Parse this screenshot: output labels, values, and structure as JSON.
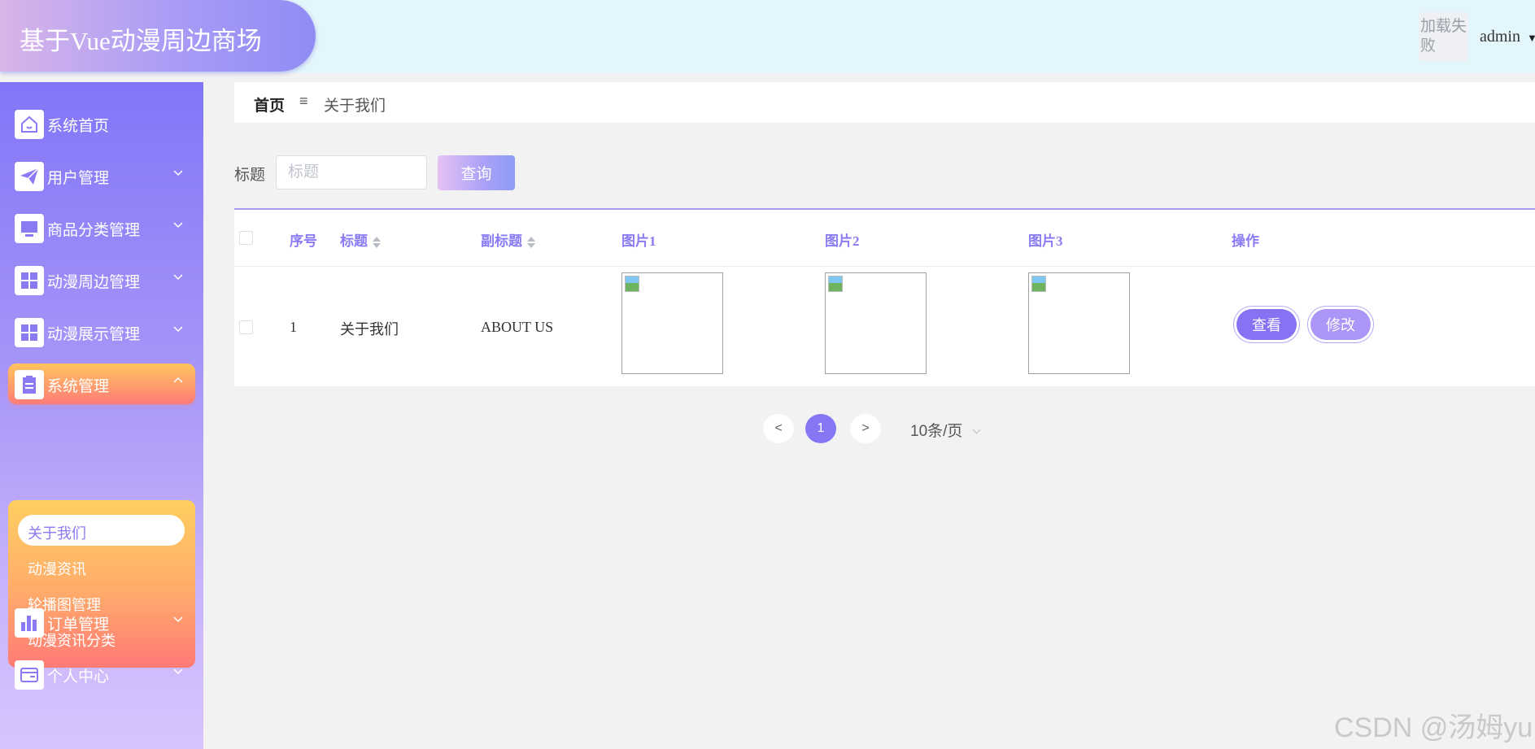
{
  "app": {
    "title": "基于Vue动漫周边商场",
    "avatar_alt": "加载失败",
    "username": "admin"
  },
  "sidebar": {
    "items": [
      {
        "label": "系统首页",
        "icon": "home-icon",
        "expandable": false
      },
      {
        "label": "用户管理",
        "icon": "paper-plane-icon",
        "expandable": true
      },
      {
        "label": "商品分类管理",
        "icon": "monitor-icon",
        "expandable": true
      },
      {
        "label": "动漫周边管理",
        "icon": "grid-icon",
        "expandable": true
      },
      {
        "label": "动漫展示管理",
        "icon": "grid-icon",
        "expandable": true
      },
      {
        "label": "系统管理",
        "icon": "clipboard-icon",
        "expandable": true,
        "active": true
      },
      {
        "label": "订单管理",
        "icon": "bar-chart-icon",
        "expandable": true
      },
      {
        "label": "个人中心",
        "icon": "card-icon",
        "expandable": true
      }
    ],
    "submenu": [
      {
        "label": "关于我们",
        "active": true
      },
      {
        "label": "动漫资讯"
      },
      {
        "label": "轮播图管理"
      },
      {
        "label": "动漫资讯分类"
      }
    ]
  },
  "breadcrumb": {
    "home": "首页",
    "separator": "≡",
    "current": "关于我们"
  },
  "search": {
    "label": "标题",
    "placeholder": "标题",
    "value": "",
    "button": "查询"
  },
  "table": {
    "headers": [
      "序号",
      "标题",
      "副标题",
      "图片1",
      "图片2",
      "图片3",
      "操作"
    ],
    "rows": [
      {
        "index": "1",
        "title": "关于我们",
        "subtitle": "ABOUT US",
        "images": [
          "broken-image",
          "broken-image",
          "broken-image"
        ],
        "actions": [
          "查看",
          "修改"
        ]
      }
    ]
  },
  "pagination": {
    "prev": "<",
    "current_page": "1",
    "next": ">",
    "page_size": "10条/页"
  },
  "watermark": "CSDN @汤姆yu",
  "colors": {
    "accent": "#8577f4",
    "active_orange": "#ff9a6e",
    "header_bg": "#e3f6fc"
  }
}
